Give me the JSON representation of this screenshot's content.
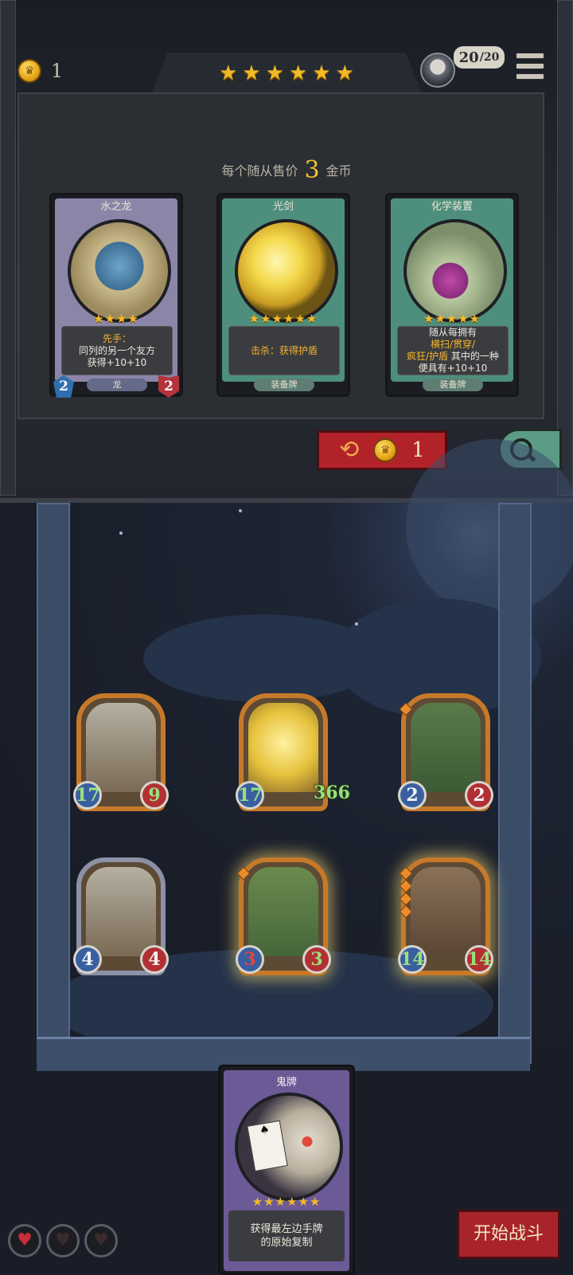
{
  "header": {
    "gold": "1",
    "tier_stars": [
      "★",
      "★",
      "★",
      "★",
      "★",
      "★"
    ],
    "health_current": "20",
    "health_max": "/20"
  },
  "shop": {
    "sell_note_prefix": "每个随从售价",
    "sell_price": "3",
    "sell_note_suffix": "金币",
    "cards": [
      {
        "name": "水之龙",
        "stars": "★★★★",
        "text_lines": [
          {
            "text": "先手：",
            "highlight": true
          },
          {
            "text": "同列的另一个友方",
            "highlight": false
          },
          {
            "text": "获得+10+10",
            "highlight": false
          }
        ],
        "tag": "龙",
        "attack": "2",
        "health": "2",
        "frame_color": "#8b86a8"
      },
      {
        "name": "光剑",
        "stars": "★★★★★★",
        "text_prefix": "击杀：获得",
        "text_highlight": "护盾",
        "tag": "装备牌",
        "frame_color": "#4d8f7c"
      },
      {
        "name": "化学装置",
        "stars": "★★★★★",
        "line1": "随从每拥有",
        "line2": "横扫/贯穿/",
        "line3": "疯狂/护盾",
        "line3_suffix": "其中的一种",
        "line4": "便具有+10+10",
        "tag": "装备牌",
        "frame_color": "#4d8f7c"
      }
    ],
    "refresh_cost": "1"
  },
  "board": {
    "units": [
      {
        "attack": "17",
        "health": "9",
        "frame": "gold",
        "glow": false
      },
      {
        "attack": "17",
        "health": "366",
        "frame": "gold",
        "glow": false
      },
      {
        "attack": "2",
        "health": "2",
        "frame": "gold",
        "glow": false
      },
      {
        "attack": "4",
        "health": "4",
        "frame": "silver",
        "glow": false
      },
      {
        "attack": "3",
        "health": "3",
        "frame": "gold",
        "glow": true
      },
      {
        "attack": "14",
        "health": "14",
        "frame": "gold",
        "glow": true
      }
    ]
  },
  "hand_card": {
    "name": "鬼牌",
    "stars": "★★★★★★",
    "text_line1": "获得最左边手牌",
    "text_line2": "的原始复制"
  },
  "footer": {
    "lives": [
      "full",
      "empty",
      "empty"
    ],
    "start_battle_label": "开始战斗"
  },
  "colors": {
    "gold_star": "#f2b928",
    "highlight_text": "#f3b52d",
    "refresh_red": "#b12329",
    "search_green": "#5c9c86",
    "start_button": "#a8242a"
  }
}
